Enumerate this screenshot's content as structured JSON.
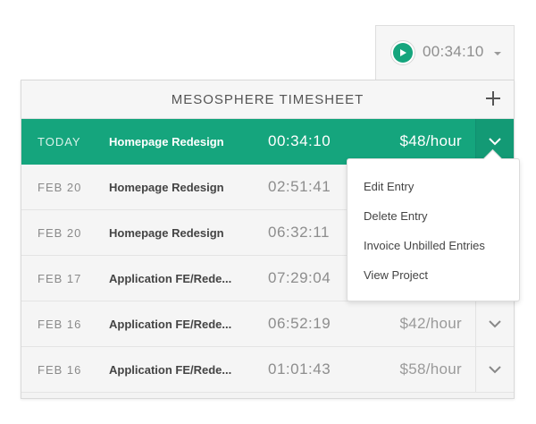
{
  "timer": {
    "elapsed": "00:34:10"
  },
  "panel": {
    "title": "MESOSPHERE TIMESHEET"
  },
  "entries": [
    {
      "date": "TODAY",
      "project": "Homepage Redesign",
      "duration": "00:34:10",
      "rate": "$48/hour",
      "active": true
    },
    {
      "date": "FEB 20",
      "project": "Homepage Redesign",
      "duration": "02:51:41",
      "rate": ""
    },
    {
      "date": "FEB 20",
      "project": "Homepage Redesign",
      "duration": "06:32:11",
      "rate": ""
    },
    {
      "date": "FEB 17",
      "project": "Application FE/Rede...",
      "duration": "07:29:04",
      "rate": ""
    },
    {
      "date": "FEB 16",
      "project": "Application FE/Rede...",
      "duration": "06:52:19",
      "rate": "$42/hour"
    },
    {
      "date": "FEB 16",
      "project": "Application FE/Rede...",
      "duration": "01:01:43",
      "rate": "$58/hour"
    }
  ],
  "menu": {
    "items": [
      "Edit Entry",
      "Delete Entry",
      "Invoice Unbilled Entries",
      "View Project"
    ]
  },
  "colors": {
    "accent": "#15a57d"
  },
  "icons": [
    "play-icon",
    "caret-down-icon",
    "plus-icon",
    "chevron-down-icon"
  ]
}
